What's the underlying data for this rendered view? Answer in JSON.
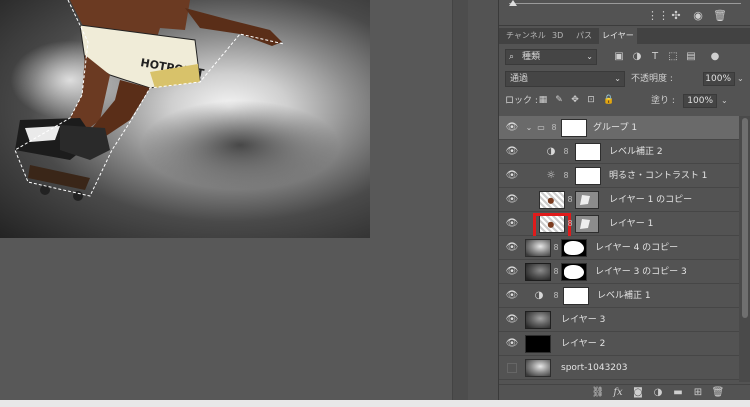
{
  "tabs": [
    "チャンネル",
    "3D",
    "パス",
    "レイヤー"
  ],
  "filter": {
    "label": "種類"
  },
  "blend": {
    "mode": "通過",
    "opacity_label": "不透明度 :",
    "opacity_value": "100%"
  },
  "lock": {
    "label": "ロック :",
    "fill_label": "塗り :",
    "fill_value": "100%"
  },
  "layers": [
    {
      "name": "グループ 1",
      "kind": "group"
    },
    {
      "name": "レベル補正 2",
      "kind": "adjustment"
    },
    {
      "name": "明るさ・コントラスト 1",
      "kind": "adjustment"
    },
    {
      "name": "レイヤー 1 のコピー",
      "kind": "masked"
    },
    {
      "name": "レイヤー 1",
      "kind": "masked"
    },
    {
      "name": "レイヤー 4 のコピー",
      "kind": "masked"
    },
    {
      "name": "レイヤー 3 のコピー 3",
      "kind": "masked"
    },
    {
      "name": "レベル補正 1",
      "kind": "adjustment"
    },
    {
      "name": "レイヤー 3",
      "kind": "pixel"
    },
    {
      "name": "レイヤー 2",
      "kind": "pixel"
    },
    {
      "name": "sport-1043203",
      "kind": "pixel"
    }
  ],
  "icons": {
    "eye": "eye-icon",
    "link": "link-icon",
    "folder": "folder-icon"
  },
  "colors": {
    "panel_bg": "#535353",
    "highlight": "#e01b1b",
    "selected_row": "#6a6a6a"
  }
}
